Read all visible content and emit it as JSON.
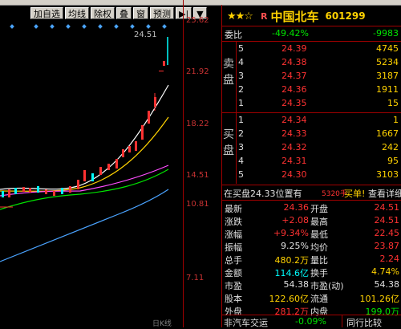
{
  "toolbar": {
    "buttons": [
      "加自选",
      "均线",
      "除权",
      "叠",
      "窗",
      "预测",
      "▶|",
      "▼"
    ]
  },
  "chart": {
    "price_ticks": [
      "25.62",
      "21.92",
      "18.22",
      "14.51",
      "10.81",
      "7.11"
    ],
    "last_price_label": "24.51",
    "bottom_label": "日K线"
  },
  "stock": {
    "stars": "★★☆",
    "r_mark": "R",
    "name": "中国北车",
    "code": "601299"
  },
  "order_book": {
    "ratio_label": "委比",
    "ratio_value": "-49.42%",
    "ratio_diff": "-9983",
    "sell_label": [
      "卖",
      "盘"
    ],
    "buy_label": [
      "买",
      "盘"
    ],
    "sells": [
      {
        "level": "5",
        "price": "24.39",
        "vol": "4745"
      },
      {
        "level": "4",
        "price": "24.38",
        "vol": "5234"
      },
      {
        "level": "3",
        "price": "24.37",
        "vol": "3187"
      },
      {
        "level": "2",
        "price": "24.36",
        "vol": "1911"
      },
      {
        "level": "1",
        "price": "24.35",
        "vol": "15"
      }
    ],
    "buys": [
      {
        "level": "1",
        "price": "24.34",
        "vol": "1"
      },
      {
        "level": "2",
        "price": "24.33",
        "vol": "1667"
      },
      {
        "level": "3",
        "price": "24.32",
        "vol": "242"
      },
      {
        "level": "4",
        "price": "24.31",
        "vol": "95"
      },
      {
        "level": "5",
        "price": "24.30",
        "vol": "3103"
      }
    ],
    "notice_a": "在买盘24.33位置有",
    "notice_vol": "5320手",
    "notice_b": "买单!",
    "notice_link": "查看详细"
  },
  "details": [
    {
      "l1": "最新",
      "v1": "24.36",
      "c1": "red",
      "l2": "开盘",
      "v2": "24.51",
      "c2": "red"
    },
    {
      "l1": "涨跌",
      "v1": "+2.08",
      "c1": "red",
      "l2": "最高",
      "v2": "24.51",
      "c2": "red"
    },
    {
      "l1": "涨幅",
      "v1": "+9.34%",
      "c1": "red",
      "l2": "最低",
      "v2": "22.45",
      "c2": "red"
    },
    {
      "l1": "振幅",
      "v1": "9.25%",
      "c1": "white",
      "l2": "均价",
      "v2": "23.87",
      "c2": "red"
    },
    {
      "l1": "总手",
      "v1": "480.2万",
      "c1": "yellow",
      "l2": "量比",
      "v2": "2.24",
      "c2": "red"
    },
    {
      "l1": "金额",
      "v1": "114.6亿",
      "c1": "cyan",
      "l2": "换手",
      "v2": "4.74%",
      "c2": "yellow"
    },
    {
      "l1": "市盈",
      "v1": "54.38",
      "c1": "white",
      "l2": "市盈(动)",
      "v2": "54.38",
      "c2": "white"
    },
    {
      "l1": "股本",
      "v1": "122.60亿",
      "c1": "yellow",
      "l2": "流通",
      "v2": "101.26亿",
      "c2": "yellow"
    },
    {
      "l1": "外盘",
      "v1": "281.2万",
      "c1": "red",
      "l2": "内盘",
      "v2": "199.0万",
      "c2": "green"
    }
  ],
  "bottom": {
    "sector": "非汽车交运",
    "sector_change": "-0.09%",
    "compare": "同行比较"
  }
}
